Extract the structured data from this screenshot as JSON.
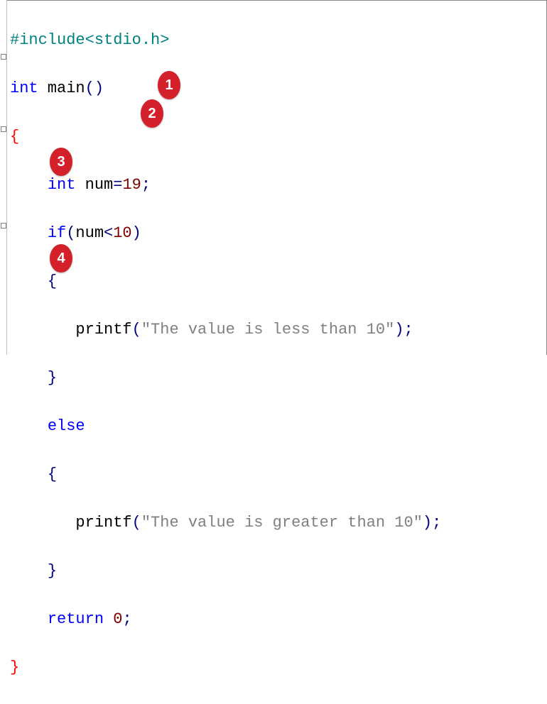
{
  "code": {
    "l1_include": "#include",
    "l1_hdr": "<stdio.h>",
    "l2_int": "int",
    "l2_main": " main",
    "l2_par": "()",
    "l3_brace": "{",
    "l4_int": "int",
    "l4_var": " num",
    "l4_eq": "=",
    "l4_val": "19",
    "l4_semi": ";",
    "l5_if": "if",
    "l5_op": "(",
    "l5_var": "num",
    "l5_lt": "<",
    "l5_ten": "10",
    "l5_cp": ")",
    "l6_brace": "{",
    "l7_printf": "printf",
    "l7_op": "(",
    "l7_str": "\"The value is less than 10\"",
    "l7_cp": ")",
    "l7_semi": ";",
    "l8_brace": "}",
    "l9_else": "else",
    "l10_brace": "{",
    "l11_printf": "printf",
    "l11_op": "(",
    "l11_str": "\"The value is greater than 10\"",
    "l11_cp": ")",
    "l11_semi": ";",
    "l12_brace": "}",
    "l13_return": "return",
    "l13_zero": " 0",
    "l13_semi": ";",
    "l14_brace": "}"
  },
  "annotations": {
    "b1": "1",
    "b2": "2",
    "b3": "3",
    "b4": "4"
  }
}
